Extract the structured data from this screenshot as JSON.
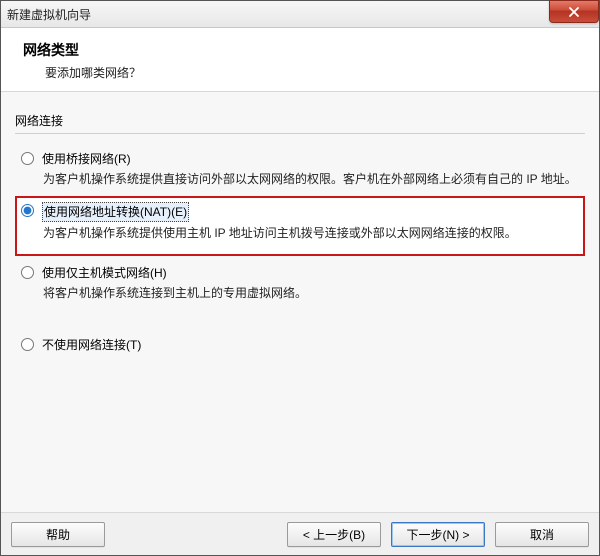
{
  "window": {
    "title": "新建虚拟机向导"
  },
  "wizard": {
    "title": "网络类型",
    "subtitle": "要添加哪类网络？"
  },
  "group": {
    "label": "网络连接"
  },
  "options": {
    "bridged": {
      "label": "使用桥接网络(R)",
      "desc": "为客户机操作系统提供直接访问外部以太网网络的权限。客户机在外部网络上必须有自己的 IP 地址。"
    },
    "nat": {
      "label": "使用网络地址转换(NAT)(E)",
      "desc": "为客户机操作系统提供使用主机 IP 地址访问主机拨号连接或外部以太网网络连接的权限。"
    },
    "hostonly": {
      "label": "使用仅主机模式网络(H)",
      "desc": "将客户机操作系统连接到主机上的专用虚拟网络。"
    },
    "none": {
      "label": "不使用网络连接(T)"
    }
  },
  "buttons": {
    "help": "帮助",
    "back": "< 上一步(B)",
    "next": "下一步(N) >",
    "cancel": "取消"
  }
}
